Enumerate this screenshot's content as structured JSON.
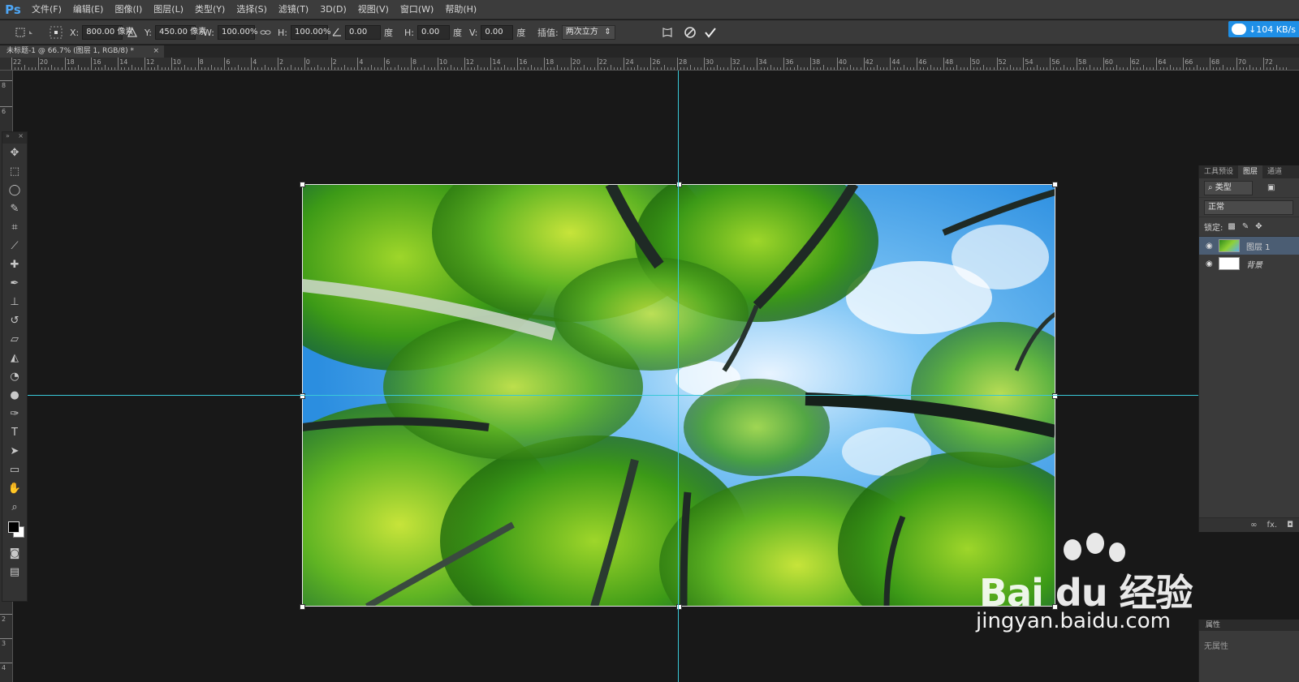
{
  "app": {
    "logo": "Ps"
  },
  "menu": [
    "文件(F)",
    "编辑(E)",
    "图像(I)",
    "图层(L)",
    "类型(Y)",
    "选择(S)",
    "滤镜(T)",
    "3D(D)",
    "视图(V)",
    "窗口(W)",
    "帮助(H)"
  ],
  "options": {
    "x_label": "X:",
    "x_value": "800.00 像素",
    "y_label": "Y:",
    "y_value": "450.00 像素",
    "w_label": "W:",
    "w_value": "100.00%",
    "h_label": "H:",
    "h_value": "100.00%",
    "angle_value": "0.00",
    "angle_unit": "度",
    "hskew_label": "H:",
    "hskew_value": "0.00",
    "hskew_unit": "度",
    "vskew_label": "V:",
    "vskew_value": "0.00",
    "vskew_unit": "度",
    "interp_label": "插值:",
    "interp_value": "两次立方"
  },
  "network": {
    "speed": "↓104 KB/s"
  },
  "document": {
    "tab_title": "未标题-1 @ 66.7% (图层 1, RGB/8) *",
    "close": "×"
  },
  "ruler": {
    "h_labels": [
      "22",
      "20",
      "18",
      "16",
      "14",
      "12",
      "10",
      "8",
      "6",
      "4",
      "2",
      "0",
      "2",
      "4",
      "6",
      "8",
      "10",
      "12",
      "14",
      "16",
      "18",
      "20",
      "22",
      "24",
      "26",
      "28",
      "30",
      "32",
      "34",
      "36",
      "38",
      "40",
      "42",
      "44",
      "46",
      "48",
      "50",
      "52",
      "54",
      "56",
      "58",
      "60",
      "62",
      "64",
      "66",
      "68",
      "70",
      "72"
    ],
    "v_labels": [
      "8",
      "6",
      "2",
      "3",
      "4"
    ]
  },
  "panels": {
    "tabs": [
      "工具预设",
      "图层",
      "通道"
    ],
    "filter_label": "类型",
    "blend_mode": "正常",
    "lock_label": "锁定:",
    "layers": [
      {
        "name": "图层 1",
        "selected": true
      },
      {
        "name": "背景",
        "selected": false
      }
    ],
    "footer_fx": "fx."
  },
  "properties": {
    "title": "属性",
    "empty": "无属性"
  },
  "watermark": {
    "brand": "Bai du 经验",
    "url": "jingyan.baidu.com"
  }
}
